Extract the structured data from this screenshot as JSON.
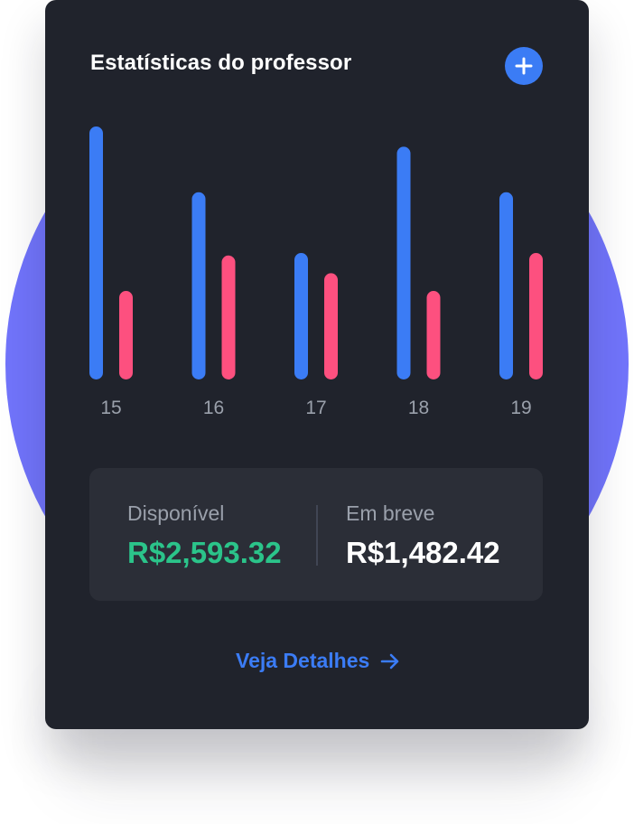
{
  "colors": {
    "circle": "#7174fb",
    "card_bg": "#20232c",
    "stats_bg": "#2b2e37",
    "accent_blue": "#3b7cf5",
    "accent_pink": "#fd507f",
    "available_green": "#2bc48a",
    "tick_label": "#9aa0ab",
    "white": "#ffffff"
  },
  "card": {
    "title": "Estatísticas do professor",
    "add_button_icon": "plus-icon"
  },
  "chart_data": {
    "type": "bar",
    "categories": [
      "15",
      "16",
      "17",
      "18",
      "19"
    ],
    "series": [
      {
        "values": [
          100,
          74,
          50,
          92,
          74
        ],
        "color": "#3b7cf5"
      },
      {
        "values": [
          35,
          49,
          42,
          35,
          50
        ],
        "color": "#fd507f"
      }
    ],
    "ylim": [
      0,
      100
    ]
  },
  "stats": {
    "available_label": "Disponível",
    "available_value": "R$2,593.32",
    "upcoming_label": "Em breve",
    "upcoming_value": "R$1,482.42"
  },
  "details_link": {
    "label": "Veja Detalhes",
    "icon": "arrow-right-icon"
  }
}
